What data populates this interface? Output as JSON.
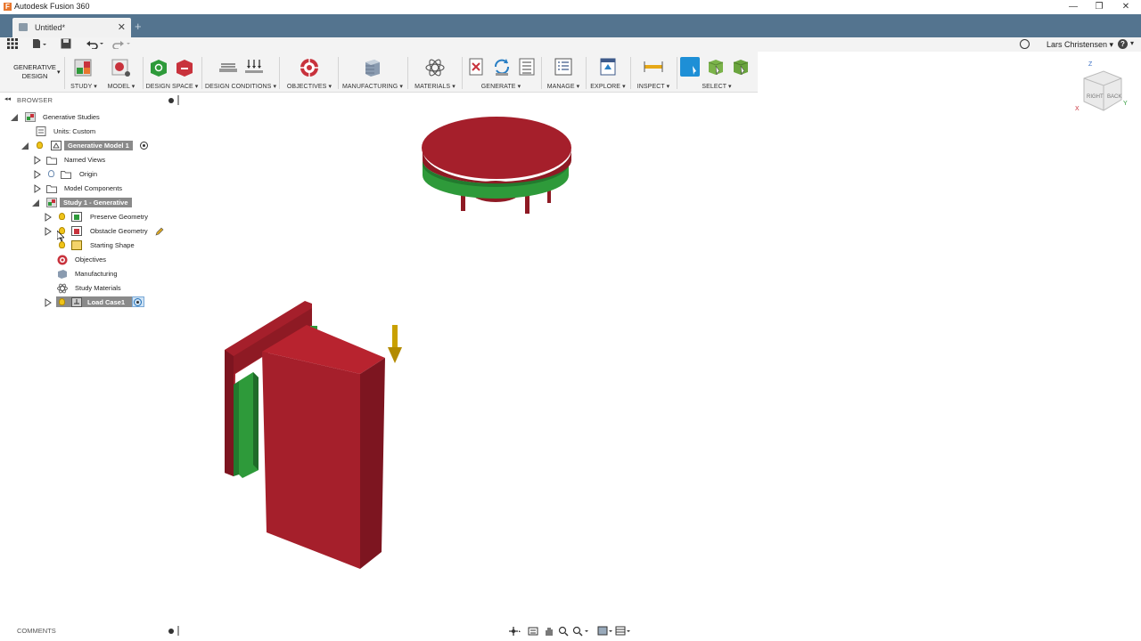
{
  "titlebar": {
    "app_icon": "F",
    "title": "Autodesk Fusion 360",
    "minimize": "—",
    "restore": "❐",
    "close": "✕"
  },
  "tab": {
    "label": "Untitled*",
    "close": "✕",
    "new_tab": "+"
  },
  "quickbar": {
    "user": "Lars Christensen ▾",
    "help_icon": "?",
    "help_caret": "▾"
  },
  "toolbar": {
    "workspace": "GENERATIVE DESIGN",
    "groups": [
      {
        "label": "STUDY ▾"
      },
      {
        "label": "MODEL ▾"
      },
      {
        "label": "DESIGN SPACE ▾"
      },
      {
        "label": "DESIGN CONDITIONS ▾"
      },
      {
        "label": "OBJECTIVES ▾"
      },
      {
        "label": "MANUFACTURING ▾"
      },
      {
        "label": "MATERIALS ▾"
      },
      {
        "label": "GENERATE ▾"
      },
      {
        "label": "MANAGE ▾"
      },
      {
        "label": "EXPLORE ▾"
      },
      {
        "label": "INSPECT ▾"
      },
      {
        "label": "SELECT ▾"
      }
    ]
  },
  "browser": {
    "header": "BROWSER",
    "collapse": "◂◂",
    "items": [
      {
        "label": "Generative Studies"
      },
      {
        "label": "Units: Custom"
      },
      {
        "label": "Generative Model 1"
      },
      {
        "label": "Named Views"
      },
      {
        "label": "Origin"
      },
      {
        "label": "Model Components"
      },
      {
        "label": "Study 1 - Generative"
      },
      {
        "label": "Preserve Geometry"
      },
      {
        "label": "Obstacle Geometry"
      },
      {
        "label": "Starting Shape"
      },
      {
        "label": "Objectives"
      },
      {
        "label": "Manufacturing"
      },
      {
        "label": "Study Materials"
      },
      {
        "label": "Load Case1"
      }
    ]
  },
  "comments": {
    "label": "COMMENTS"
  },
  "viewcube": {
    "face_right": "RIGHT",
    "face_back": "BACK",
    "axis_z": "Z",
    "axis_x": "X",
    "axis_y": "Y"
  },
  "colors": {
    "obstacle": "#a51f2b",
    "preserve": "#2e9a3a",
    "load_arrow": "#c9a000",
    "tabbar": "#54748f",
    "highlight": "#8a8a8a"
  }
}
